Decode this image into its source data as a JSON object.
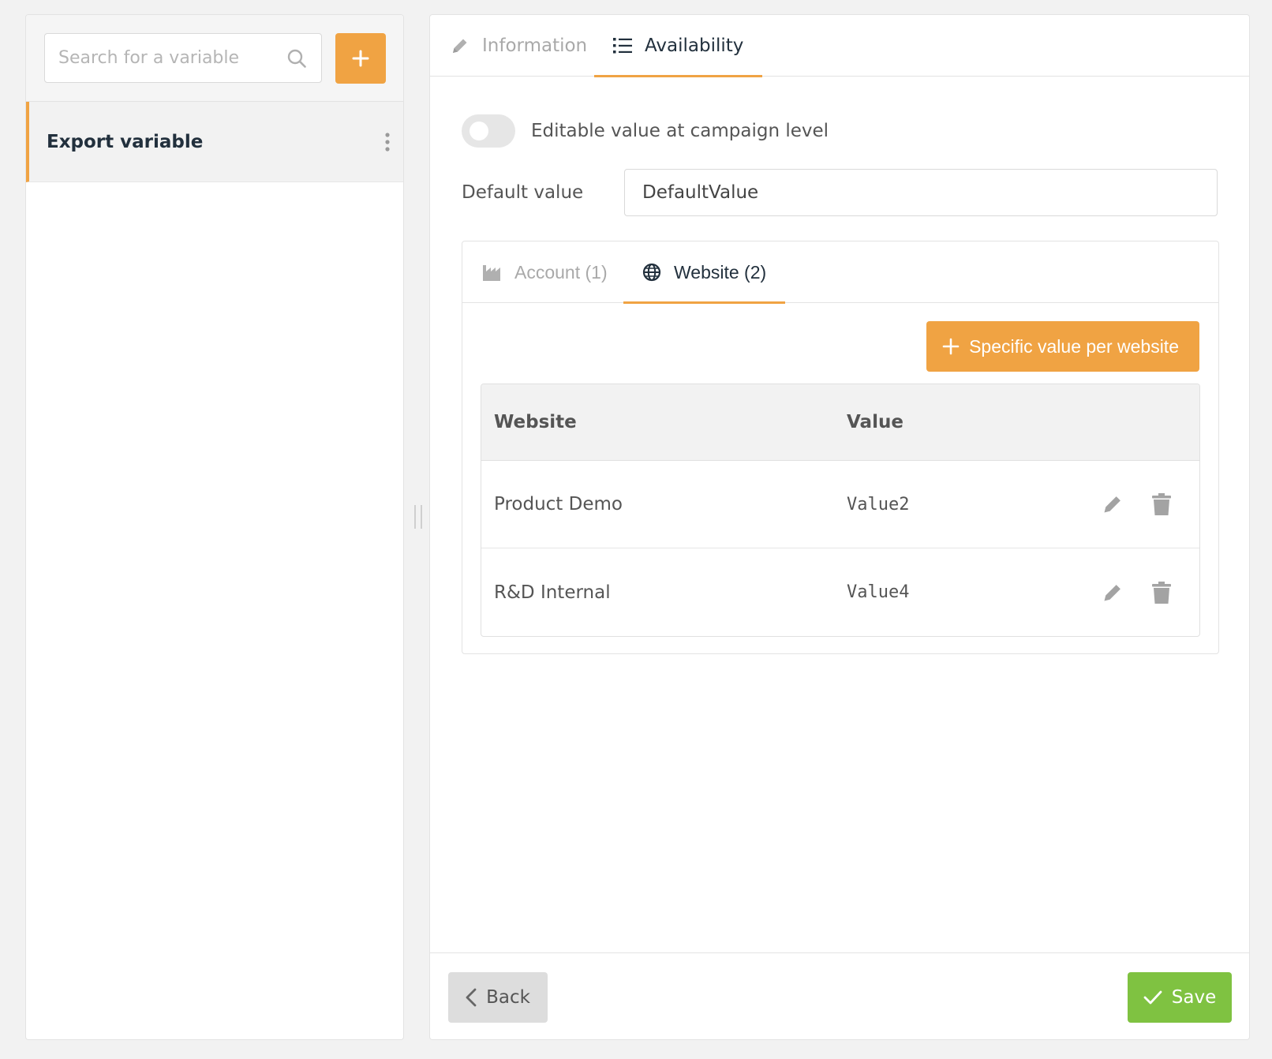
{
  "colors": {
    "accent": "#f0a343",
    "save": "#7fc241",
    "back": "#dddddd",
    "heading_text": "#22303d",
    "muted_text": "#a9a9a9"
  },
  "sidebar": {
    "search": {
      "placeholder": "Search for a variable",
      "icon": "search-icon"
    },
    "add_button": {
      "icon": "plus-icon"
    },
    "items": [
      {
        "label": "Export variable",
        "selected": true,
        "menu_icon": "kebab-menu-icon"
      }
    ]
  },
  "main": {
    "tabs": [
      {
        "label": "Information",
        "icon": "pencil-icon",
        "active": false
      },
      {
        "label": "Availability",
        "icon": "list-icon",
        "active": true
      }
    ],
    "editable_toggle": {
      "label": "Editable value at campaign level",
      "checked": false
    },
    "default_value": {
      "label": "Default value",
      "value": "DefaultValue"
    },
    "scope_tabs": [
      {
        "label": "Account (1)",
        "icon": "factory-icon",
        "active": false
      },
      {
        "label": "Website (2)",
        "icon": "globe-icon",
        "active": true
      }
    ],
    "specific_button": {
      "label": "Specific value per website",
      "icon": "plus-icon"
    },
    "table": {
      "columns": [
        "Website",
        "Value"
      ],
      "rows": [
        {
          "website": "Product Demo",
          "value": "Value2"
        },
        {
          "website": "R&D Internal",
          "value": "Value4"
        }
      ]
    }
  },
  "footer": {
    "back_label": "Back",
    "save_label": "Save"
  }
}
